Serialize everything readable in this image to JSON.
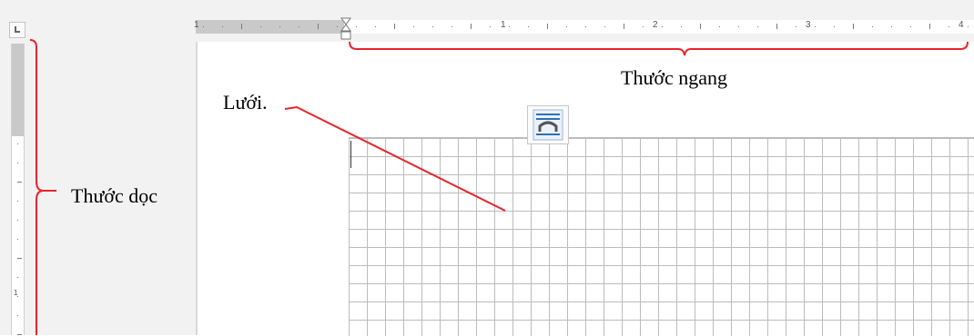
{
  "annotations": {
    "horizontal_ruler": "Thước ngang",
    "vertical_ruler": "Thước dọc",
    "grid": "Lưới."
  },
  "horizontal_ruler": {
    "numbers": [
      "1",
      "1",
      "2",
      "3",
      "4"
    ]
  },
  "vertical_ruler": {
    "numbers": [
      "1"
    ]
  },
  "colors": {
    "annotation_red": "#e8242b",
    "grid_line": "#bcbcbc",
    "ruler_margin": "#c9c9c9",
    "chrome": "#f2f2f2",
    "layout_icon_blue": "#2e6fb7"
  },
  "icons": {
    "tab_selector": "left-tab-icon",
    "layout_options": "layout-options-icon",
    "indent_marker": "indent-marker-icon"
  }
}
